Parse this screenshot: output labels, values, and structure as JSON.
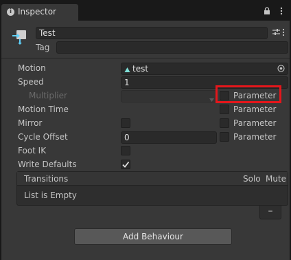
{
  "window": {
    "tab_title": "Inspector",
    "tab_icon": "info-icon",
    "tools": [
      "lock-icon",
      "kebab-menu-icon"
    ]
  },
  "header": {
    "icon": "state-node-icon",
    "name_value": "Test",
    "tag_label": "Tag",
    "tag_value": ""
  },
  "properties": {
    "motion_label": "Motion",
    "motion_value": "test",
    "motion_icon": "animation-clip-icon",
    "speed_label": "Speed",
    "speed_value": "1",
    "multiplier_label": "Multiplier",
    "multiplier_value": "",
    "motion_time_label": "Motion Time",
    "mirror_label": "Mirror",
    "cycle_offset_label": "Cycle Offset",
    "cycle_offset_value": "0",
    "foot_ik_label": "Foot IK",
    "write_defaults_label": "Write Defaults",
    "write_defaults_checked": true,
    "parameter_label": "Parameter"
  },
  "transitions": {
    "title": "Transitions",
    "solo_label": "Solo",
    "mute_label": "Mute",
    "empty_text": "List is Empty",
    "remove_label": "–"
  },
  "footer": {
    "add_behaviour_label": "Add Behaviour"
  },
  "colors": {
    "highlight": "#e4161b",
    "panel": "#383838",
    "field": "#2a2a2a"
  }
}
